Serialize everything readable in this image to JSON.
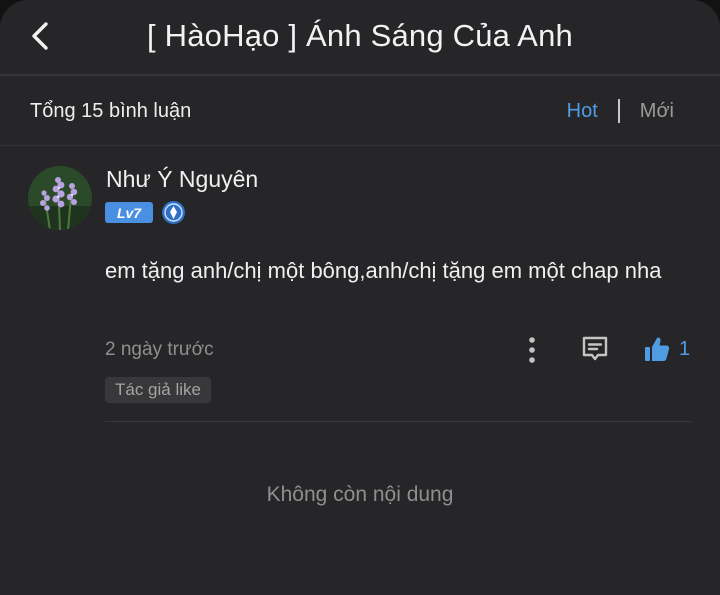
{
  "header": {
    "title": "[ HàoHạo ] Ánh Sáng Của Anh",
    "back_icon": "chevron-left-icon"
  },
  "comments_bar": {
    "count_label": "Tổng 15 bình luận",
    "sort_hot": "Hot",
    "sort_new": "Mới",
    "active_sort": "Hot"
  },
  "comment": {
    "username": "Như Ý Nguyên",
    "level": "Lv7",
    "text": "em tặng anh/chị một bông,anh/chị tặng em một chap nha",
    "time": "2 ngày trước",
    "like_count": "1",
    "author_tag": "Tác giả like"
  },
  "footer": {
    "end_message": "Không còn nội dung"
  },
  "colors": {
    "background": "#262628",
    "accent": "#4f9ce3",
    "level_badge": "#4a90e2",
    "muted_text": "#8f8f8f"
  }
}
